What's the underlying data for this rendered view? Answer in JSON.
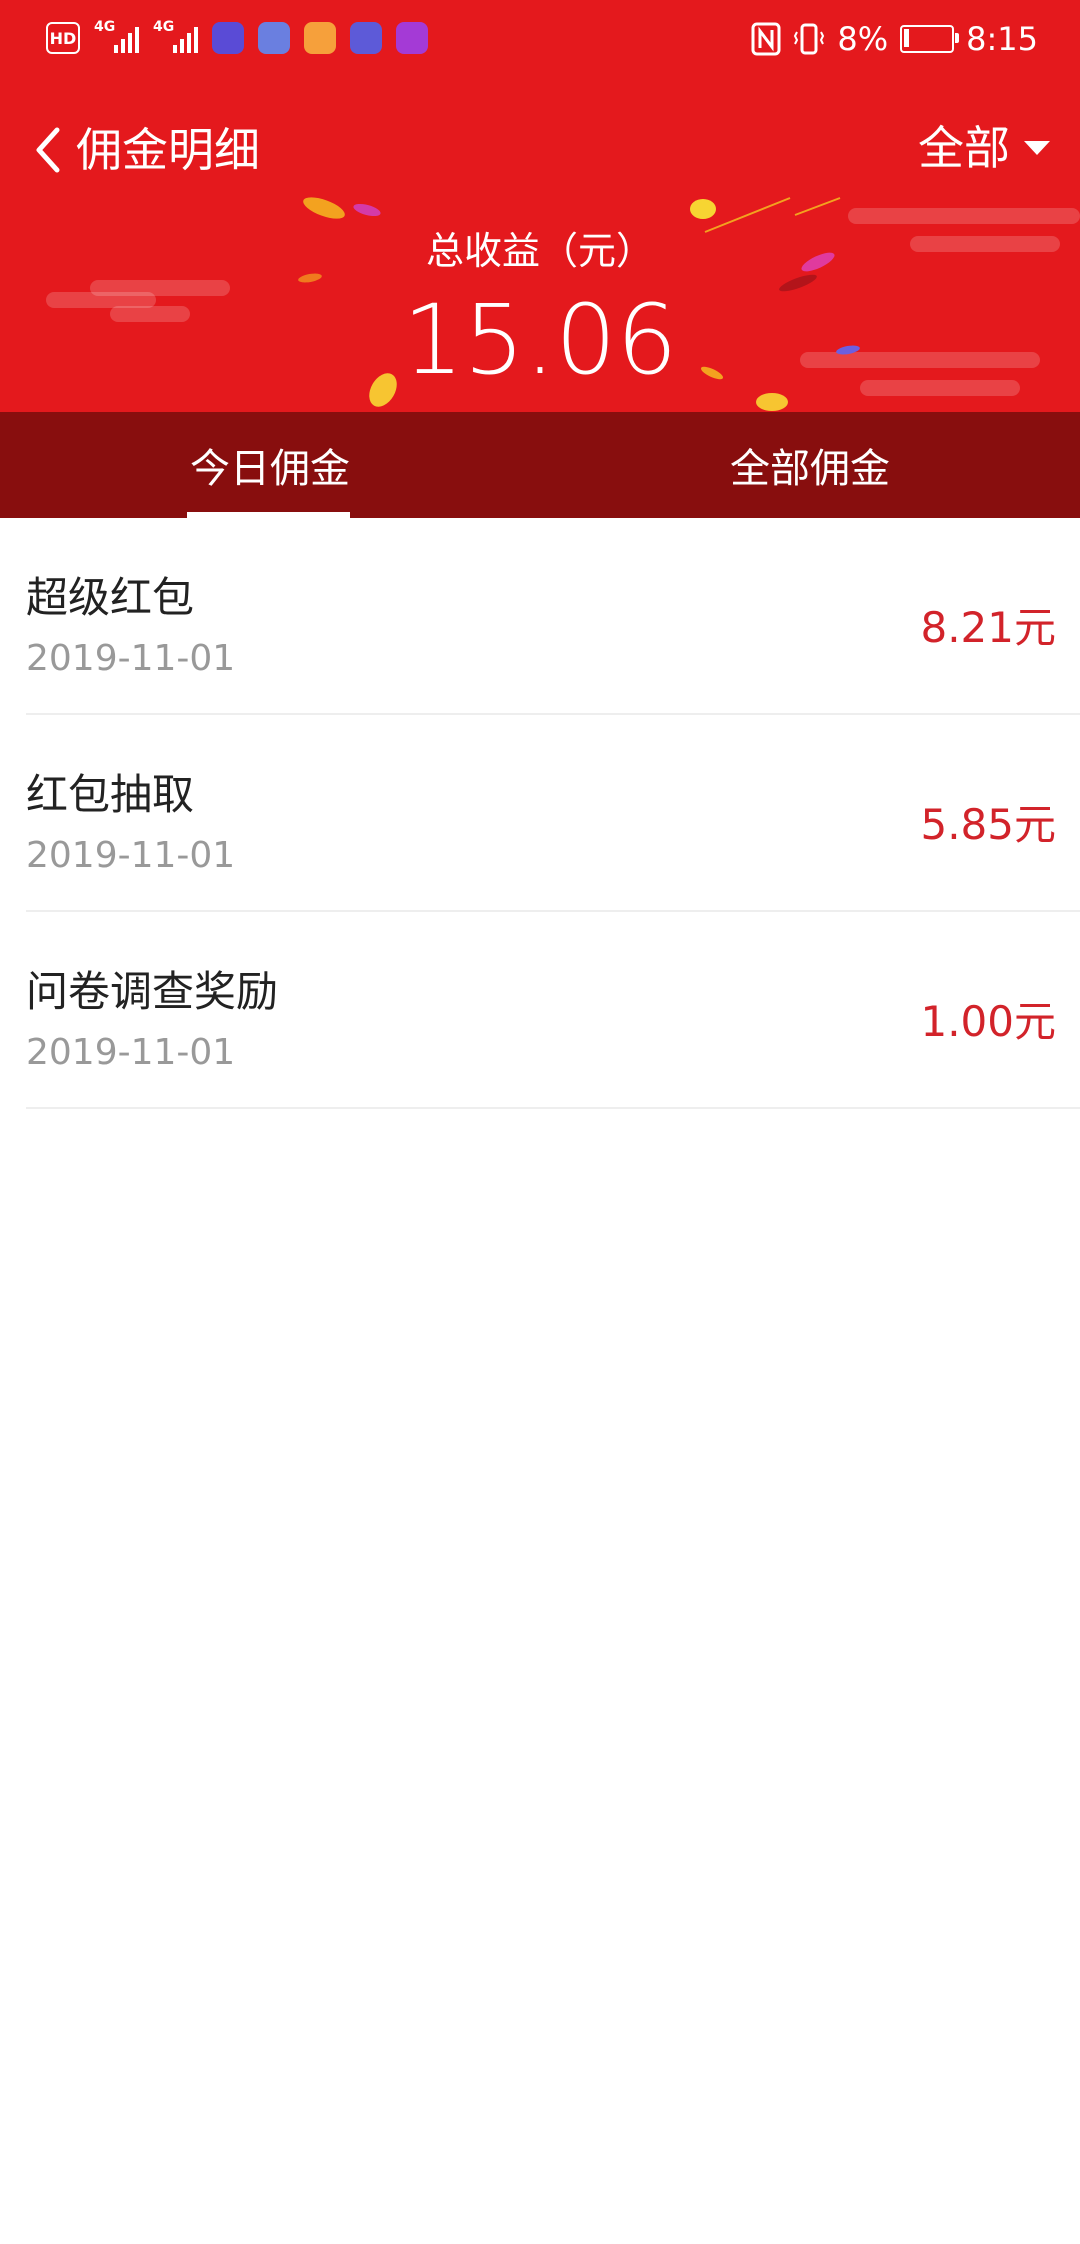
{
  "status_bar": {
    "left_badge": "HD",
    "network1": "4G",
    "network2": "4G",
    "battery_percent": "8%",
    "time": "8:15",
    "icons": [
      "hd-icon",
      "signal-4g-icon",
      "signal-4g-icon",
      "shield-app-icon",
      "wallet-app-icon",
      "star-app-icon",
      "broadcast-app-icon",
      "video-app-icon",
      "nfc-icon",
      "vibrate-icon",
      "battery-icon"
    ]
  },
  "navbar": {
    "title": "佣金明细",
    "filter_label": "全部"
  },
  "summary": {
    "label": "总收益（元）",
    "value": "15.06"
  },
  "tabs": [
    {
      "label": "今日佣金",
      "active": true
    },
    {
      "label": "全部佣金",
      "active": false
    }
  ],
  "records": [
    {
      "title": "超级红包",
      "date": "2019-11-01",
      "amount": "8.21元"
    },
    {
      "title": "红包抽取",
      "date": "2019-11-01",
      "amount": "5.85元"
    },
    {
      "title": "问卷调查奖励",
      "date": "2019-11-01",
      "amount": "1.00元"
    }
  ],
  "colors": {
    "header_red": "#e4191d",
    "tab_bar": "#880e0e",
    "amount_red": "#d2232a"
  }
}
